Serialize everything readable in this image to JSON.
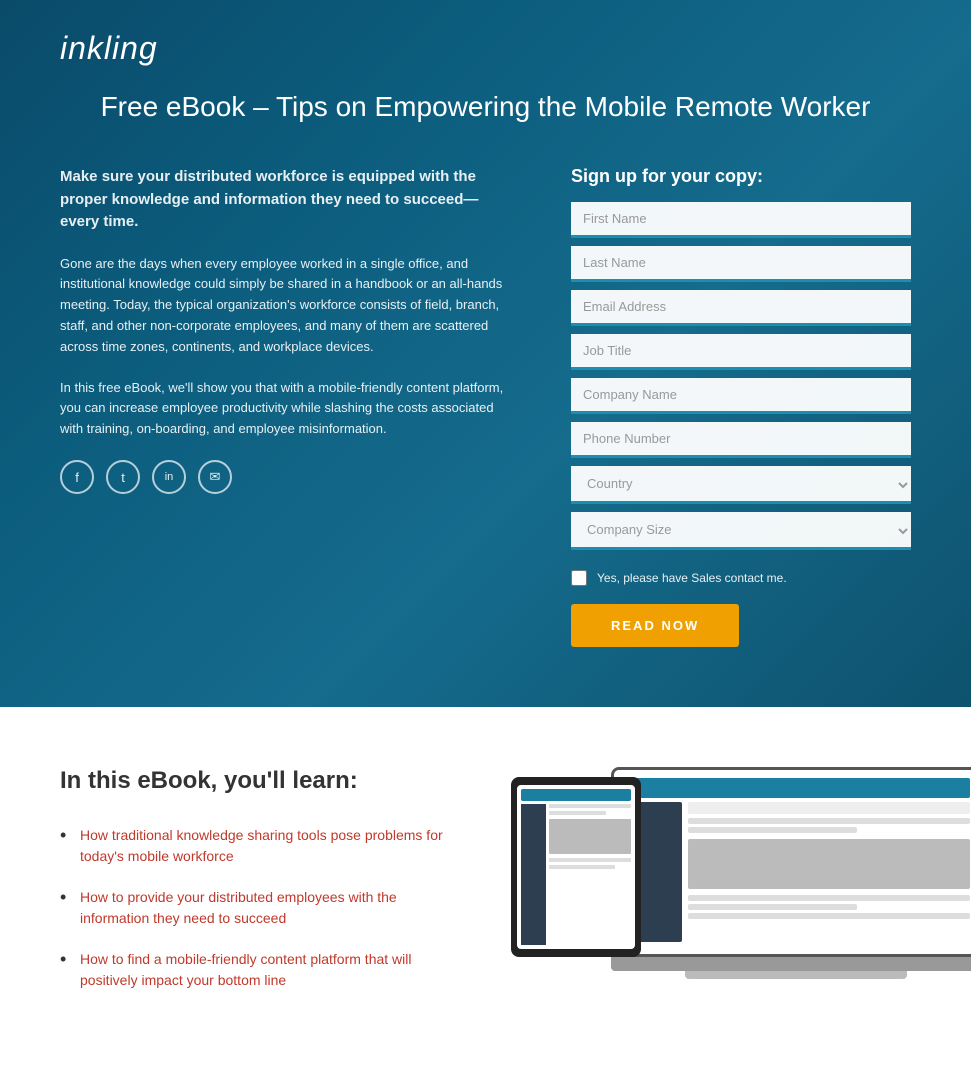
{
  "logo": {
    "text": "inkling"
  },
  "hero": {
    "title": "Free eBook – Tips on Empowering the Mobile Remote Worker",
    "headline": "Make sure your distributed workforce is equipped with the proper knowledge and information they need to succeed—every time.",
    "paragraph1": "Gone are the days when every employee worked in a single office, and institutional knowledge could simply be shared in a handbook or an all-hands meeting. Today, the typical organization's workforce consists of field, branch, staff, and other non-corporate employees, and many of them are scattered across time zones, continents, and workplace devices.",
    "paragraph2": "In this free eBook, we'll show you that with a mobile-friendly content platform, you can increase employee productivity while slashing the costs associated with training, on-boarding, and employee misinformation.",
    "form": {
      "title": "Sign up for your copy:",
      "fields": {
        "first_name": "First Name",
        "last_name": "Last Name",
        "email": "Email Address",
        "job_title": "Job Title",
        "company_name": "Company Name",
        "phone_number": "Phone Number"
      },
      "dropdown1_placeholder": "Country",
      "dropdown2_placeholder": "Company Size",
      "checkbox_label": "Yes, please have Sales contact me.",
      "submit_button": "READ NOW"
    },
    "social": {
      "facebook": "f",
      "twitter": "t",
      "linkedin": "in",
      "email": "✉"
    }
  },
  "lower": {
    "title": "In this eBook, you'll learn:",
    "items": [
      {
        "link_text": "How traditional knowledge sharing tools pose problems for today's mobile workforce",
        "suffix": ""
      },
      {
        "link_text": "How to provide your distributed employees with the information they need to succeed",
        "suffix": ""
      },
      {
        "link_text": "How to find a mobile-friendly content platform that will positively impact your bottom line",
        "suffix": ""
      }
    ]
  }
}
